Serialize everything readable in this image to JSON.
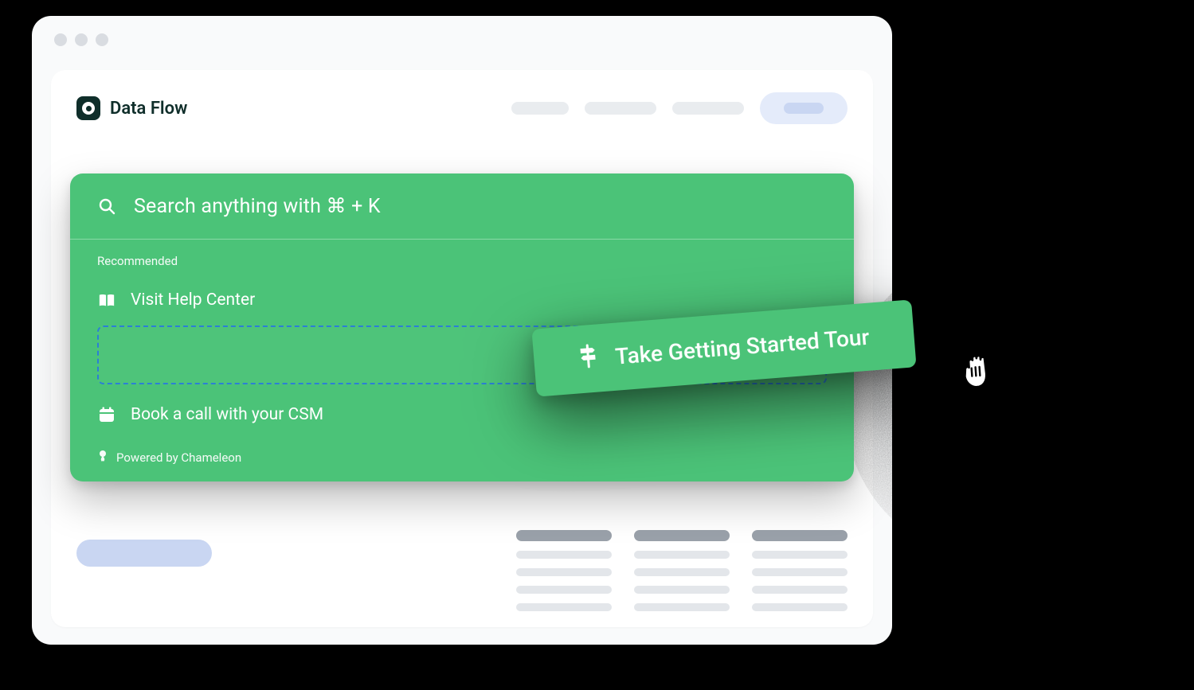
{
  "brand": {
    "name": "Data Flow"
  },
  "palette": {
    "search_placeholder": "Search anything with ⌘ + K",
    "section_label": "Recommended",
    "items": {
      "help_center": "Visit Help Center",
      "book_call": "Book a call with your CSM"
    },
    "footer": "Powered by Chameleon"
  },
  "floating": {
    "label": "Take Getting Started Tour"
  },
  "icons": {
    "search": "search-icon",
    "book": "book-icon",
    "calendar": "calendar-icon",
    "signpost": "signpost-icon",
    "chameleon": "chameleon-icon"
  }
}
